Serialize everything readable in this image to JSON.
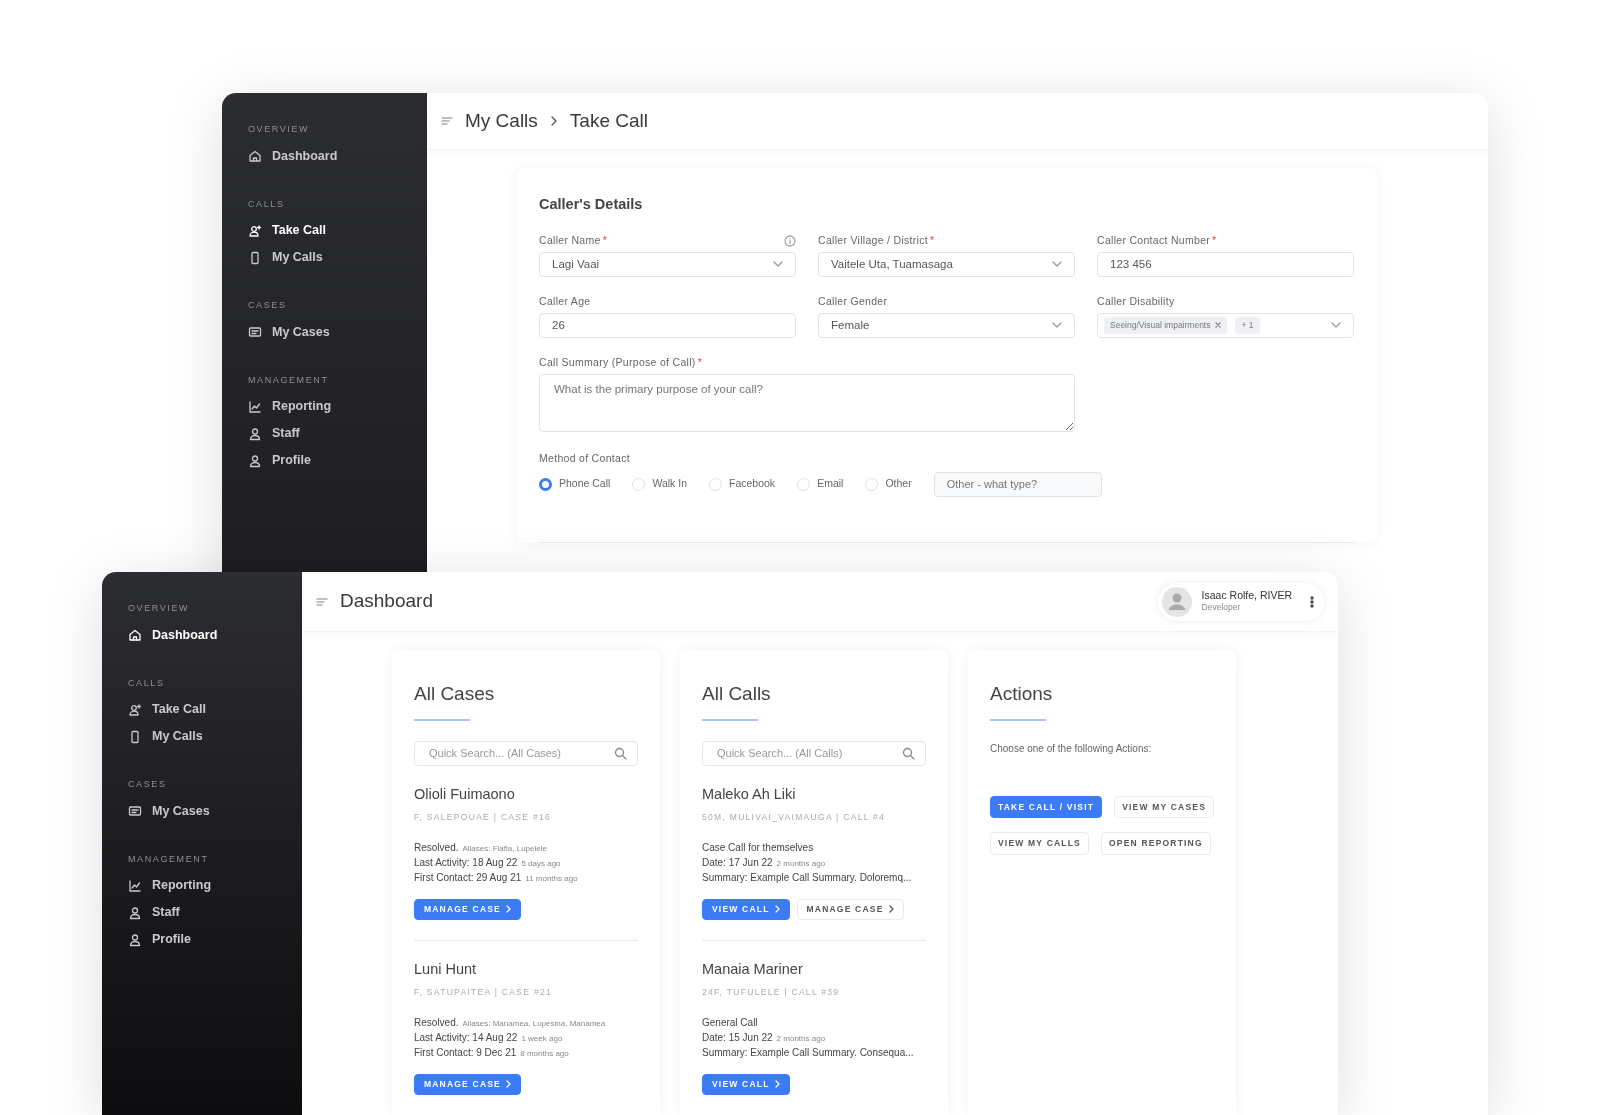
{
  "back_window": {
    "sidebar": [
      {
        "heading": "OVERVIEW",
        "items": [
          {
            "label": "Dashboard",
            "kind": "home",
            "selected": false
          }
        ]
      },
      {
        "heading": "CALLS",
        "items": [
          {
            "label": "Take Call",
            "kind": "person-add",
            "selected": true
          },
          {
            "label": "My Calls",
            "kind": "phone",
            "selected": false
          }
        ]
      },
      {
        "heading": "CASES",
        "items": [
          {
            "label": "My Cases",
            "kind": "cases",
            "selected": false
          }
        ]
      },
      {
        "heading": "MANAGEMENT",
        "items": [
          {
            "label": "Reporting",
            "kind": "chart",
            "selected": false
          },
          {
            "label": "Staff",
            "kind": "person",
            "selected": false
          },
          {
            "label": "Profile",
            "kind": "person",
            "selected": false
          }
        ]
      }
    ],
    "breadcrumb": [
      "My Calls",
      "Take Call"
    ],
    "form": {
      "title": "Caller's Details",
      "fields": [
        {
          "kind": "select",
          "label": "Caller Name",
          "required_mark": "*",
          "info": true,
          "value": "Lagi Vaai"
        },
        {
          "kind": "select",
          "label": "Caller Village / District",
          "required_mark": "*",
          "value": "Vaitele Uta, Tuamasaga"
        },
        {
          "kind": "input",
          "label": "Caller Contact Number",
          "required_mark": "*",
          "value": "123 456"
        },
        {
          "kind": "input",
          "label": "Caller Age",
          "value": "26"
        },
        {
          "kind": "select",
          "label": "Caller Gender",
          "value": "Female"
        },
        {
          "kind": "tags",
          "label": "Caller Disability",
          "tags": [
            "Seeing/Visual impairments"
          ],
          "more": "+ 1"
        },
        {
          "kind": "textarea",
          "label": "Call Summary (Purpose of Call)",
          "required_mark": "*",
          "placeholder": "What is the primary purpose of your call?"
        }
      ],
      "method": {
        "label": "Method of Contact",
        "options": [
          {
            "label": "Phone Call",
            "selected": true
          },
          {
            "label": "Walk In",
            "selected": false
          },
          {
            "label": "Facebook",
            "selected": false
          },
          {
            "label": "Email",
            "selected": false
          },
          {
            "label": "Other",
            "selected": false
          }
        ],
        "other_placeholder": "Other - what type?"
      }
    }
  },
  "front_window": {
    "sidebar": [
      {
        "heading": "OVERVIEW",
        "items": [
          {
            "label": "Dashboard",
            "kind": "home",
            "selected": true
          }
        ]
      },
      {
        "heading": "CALLS",
        "items": [
          {
            "label": "Take Call",
            "kind": "person-add",
            "selected": false
          },
          {
            "label": "My Calls",
            "kind": "phone",
            "selected": false
          }
        ]
      },
      {
        "heading": "CASES",
        "items": [
          {
            "label": "My Cases",
            "kind": "cases",
            "selected": false
          }
        ]
      },
      {
        "heading": "MANAGEMENT",
        "items": [
          {
            "label": "Reporting",
            "kind": "chart",
            "selected": false
          },
          {
            "label": "Staff",
            "kind": "person",
            "selected": false
          },
          {
            "label": "Profile",
            "kind": "person",
            "selected": false
          }
        ]
      }
    ],
    "title": "Dashboard",
    "user": {
      "name": "Isaac Rolfe, RIVER",
      "role": "Developer"
    },
    "cards": [
      {
        "kind": "list",
        "title": "All Cases",
        "search_placeholder": "Quick Search... (All Cases)",
        "items": [
          {
            "name": "Olioli Fuimaono",
            "meta": "F, SALEPOUAE | CASE #16",
            "lines": [
              {
                "text": "Resolved.",
                "note": "Aliases: Fiafia, Lupelele"
              },
              {
                "text": "Last Activity: 18 Aug 22",
                "note": "5 days ago"
              },
              {
                "text": "First Contact: 29 Aug 21",
                "note": "11 months ago"
              }
            ],
            "buttons": [
              {
                "label": "MANAGE CASE",
                "kind": "primary"
              }
            ]
          },
          {
            "name": "Luni Hunt",
            "meta": "F, SATUPAITEA | CASE #21",
            "lines": [
              {
                "text": "Resolved.",
                "note": "Aliases: Manamea, Lupesina, Manamea"
              },
              {
                "text": "Last Activity: 14 Aug 22",
                "note": "1 week ago"
              },
              {
                "text": "First Contact: 9 Dec 21",
                "note": "8 months ago"
              }
            ],
            "buttons": [
              {
                "label": "MANAGE CASE",
                "kind": "primary"
              }
            ]
          }
        ]
      },
      {
        "kind": "list",
        "title": "All Calls",
        "search_placeholder": "Quick Search... (All Calls)",
        "items": [
          {
            "name": "Maleko Ah Liki",
            "meta": "50M, MULIVAI_VAIMAUGA | CALL #4",
            "lines": [
              {
                "text": "Case Call for themselves"
              },
              {
                "text": "Date: 17 Jun 22",
                "note": "2 months ago"
              },
              {
                "text": "Summary: Example Call Summary. Doloremq..."
              }
            ],
            "buttons": [
              {
                "label": "VIEW CALL",
                "kind": "primary"
              },
              {
                "label": "MANAGE CASE",
                "kind": "outline"
              }
            ]
          },
          {
            "name": "Manaia Mariner",
            "meta": "24F, TUFULELE | CALL #39",
            "lines": [
              {
                "text": "General Call"
              },
              {
                "text": "Date: 15 Jun 22",
                "note": "2 months ago"
              },
              {
                "text": "Summary: Example Call Summary. Consequa..."
              }
            ],
            "buttons": [
              {
                "label": "VIEW CALL",
                "kind": "primary"
              }
            ]
          }
        ]
      },
      {
        "kind": "actions",
        "title": "Actions",
        "text": "Choose one of the following Actions:",
        "buttons": [
          {
            "label": "TAKE CALL / VISIT",
            "kind": "primary"
          },
          {
            "label": "VIEW MY CASES",
            "kind": "outline"
          },
          {
            "label": "VIEW MY CALLS",
            "kind": "outline"
          },
          {
            "label": "OPEN REPORTING",
            "kind": "outline"
          }
        ]
      }
    ]
  }
}
